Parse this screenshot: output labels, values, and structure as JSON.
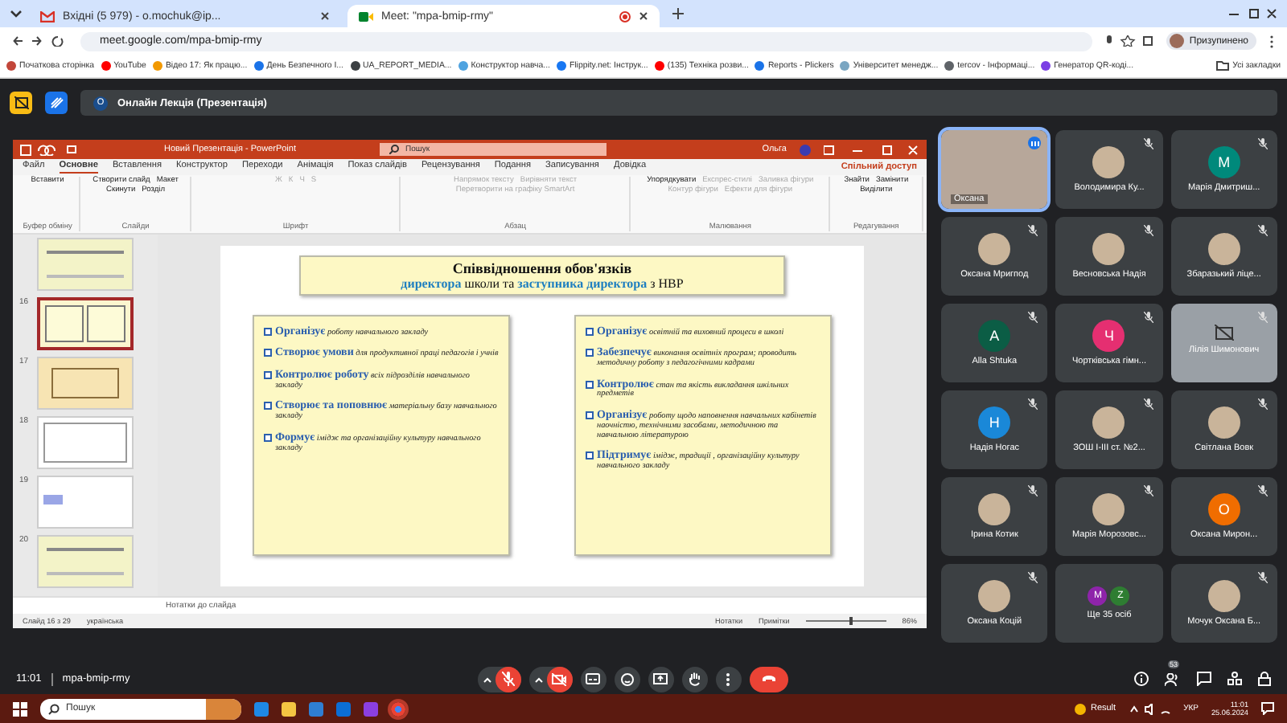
{
  "browser": {
    "tabs": [
      {
        "title": "Вхідні (5 979) - o.mochuk@ip...",
        "kind": "mail",
        "selected": false
      },
      {
        "title": "Meet: \"mpa-bmip-rmy\"",
        "kind": "meet",
        "selected": true
      }
    ],
    "url": "meet.google.com/mpa-bmip-rmy",
    "profile_label": "Призупинено",
    "bookmarks": [
      {
        "title": "Початкова сторінка",
        "color": "#c2463a"
      },
      {
        "title": "YouTube",
        "color": "#ff0000"
      },
      {
        "title": "Відео 17: Як працю...",
        "color": "#f29900"
      },
      {
        "title": "День Безпечного І...",
        "color": "#1a73e8"
      },
      {
        "title": "UA_REPORT_MEDIA...",
        "color": "#3c4043"
      },
      {
        "title": "Конструктор навча...",
        "color": "#4fa3e0"
      },
      {
        "title": "Flippity.net: Інструк...",
        "color": "#1877f2"
      },
      {
        "title": "(135) Техніка розви...",
        "color": "#ff0000"
      },
      {
        "title": "Reports - Plickers",
        "color": "#1a73e8"
      },
      {
        "title": "Університет менедж...",
        "color": "#7aa6c2"
      },
      {
        "title": "tercov - Інформаці...",
        "color": "#5f6368"
      },
      {
        "title": "Генератор QR-коді...",
        "color": "#7b3fe4"
      }
    ],
    "all_bookmarks": "Усі закладки"
  },
  "meet_header": {
    "initial": "О",
    "title": "Онлайн Лекція (Презентація)"
  },
  "powerpoint": {
    "title": "Новий Презентація - PowerPoint",
    "search": "Пошук",
    "user": "Ольга",
    "menu": [
      {
        "label": "Файл",
        "selected": false
      },
      {
        "label": "Основне",
        "selected": true
      },
      {
        "label": "Вставлення",
        "selected": false
      },
      {
        "label": "Конструктор",
        "selected": false
      },
      {
        "label": "Переходи",
        "selected": false
      },
      {
        "label": "Анімація",
        "selected": false
      },
      {
        "label": "Показ слайдів",
        "selected": false
      },
      {
        "label": "Рецензування",
        "selected": false
      },
      {
        "label": "Подання",
        "selected": false
      },
      {
        "label": "Записування",
        "selected": false
      },
      {
        "label": "Довідка",
        "selected": false
      }
    ],
    "share": "Спільний доступ",
    "ribbon": [
      {
        "label": "Буфер обміну",
        "buttons": [
          {
            "label": "Вставити",
            "disabled": false
          }
        ]
      },
      {
        "label": "Слайди",
        "buttons": [
          {
            "label": "Створити слайд",
            "disabled": false
          },
          {
            "label": "Макет",
            "disabled": false
          },
          {
            "label": "Скинути",
            "disabled": false
          },
          {
            "label": "Розділ",
            "disabled": false
          }
        ]
      },
      {
        "label": "Шрифт",
        "buttons": [
          {
            "label": "Ж",
            "disabled": true
          },
          {
            "label": "К",
            "disabled": true
          },
          {
            "label": "Ч",
            "disabled": true
          },
          {
            "label": "S",
            "disabled": true
          }
        ]
      },
      {
        "label": "Абзац",
        "buttons": [
          {
            "label": "Напрямок тексту",
            "disabled": true
          },
          {
            "label": "Вирівняти текст",
            "disabled": true
          },
          {
            "label": "Перетворити на графіку SmartArt",
            "disabled": true
          }
        ]
      },
      {
        "label": "Малювання",
        "buttons": [
          {
            "label": "Упорядкувати",
            "disabled": false
          },
          {
            "label": "Експрес-стилі",
            "disabled": true
          },
          {
            "label": "Заливка фігури",
            "disabled": true
          },
          {
            "label": "Контур фігури",
            "disabled": true
          },
          {
            "label": "Ефекти для фігури",
            "disabled": true
          }
        ]
      },
      {
        "label": "Редагування",
        "buttons": [
          {
            "label": "Знайти",
            "disabled": false
          },
          {
            "label": "Замінити",
            "disabled": false
          },
          {
            "label": "Виділити",
            "disabled": false
          }
        ]
      }
    ],
    "thumbnails": [
      {
        "kind": "text",
        "selected": false
      },
      {
        "number": "16",
        "kind": "columns",
        "selected": true
      },
      {
        "number": "17",
        "kind": "boxes",
        "selected": false
      },
      {
        "number": "18",
        "kind": "table",
        "selected": false
      },
      {
        "number": "19",
        "kind": "mindmap",
        "selected": false
      },
      {
        "number": "20",
        "kind": "text",
        "selected": false
      }
    ],
    "slide": {
      "title": "Співвідношення обов'язків",
      "subtitle": [
        {
          "text": "директора",
          "accent": true
        },
        {
          "text": " школи та ",
          "accent": false
        },
        {
          "text": "заступника директора",
          "accent": true
        },
        {
          "text": " з  НВР",
          "accent": false
        }
      ],
      "columns": [
        [
          {
            "verb": "Організує",
            "rest": "роботу навчального закладу"
          },
          {
            "verb": "Створює умови",
            "rest": "для продуктивної праці педагогів і учнів"
          },
          {
            "verb": "Контролює роботу",
            "rest": "всіх підрозділів навчального закладу"
          },
          {
            "verb": "Створює та поповнює",
            "rest": "матеріальну базу навчального закладу"
          },
          {
            "verb": "Формує",
            "rest": "імідж та організаційну культуру навчального закладу"
          }
        ],
        [
          {
            "verb": "Організує",
            "rest": "освітній та виховний процеси в школі"
          },
          {
            "verb": "Забезпечує",
            "rest": "виконання освітніх програм; проводить методичну роботу з педагогічними кадрами"
          },
          {
            "verb": "Контролює",
            "rest": "стан та якість викладання шкільних предметів"
          },
          {
            "verb": "Організує",
            "rest": "роботу щодо наповнення навчальних кабінетів наочністю, технічними засобами, методичною та навчальною літературою"
          },
          {
            "verb": "Підтримує",
            "rest": "імідж, традиції , організаційну культуру навчального закладу"
          }
        ]
      ]
    },
    "notes": "Нотатки до слайда",
    "status": {
      "slide": "Слайд 16 з 29",
      "language": "українська",
      "notes": "Нотатки",
      "comments": "Примітки",
      "zoom_slider": {
        "level": 0.55
      },
      "zoom": "86%"
    }
  },
  "participants": [
    {
      "name": "Оксана",
      "kind": "video",
      "speaking": true,
      "muted": false
    },
    {
      "name": "Володимира Ку...",
      "kind": "photo",
      "speaking": false,
      "muted": true
    },
    {
      "name": "Марія Дмитриш...",
      "kind": "letter",
      "letter": "М",
      "color": "#00897b",
      "speaking": false,
      "muted": true
    },
    {
      "name": "Оксана Мригпод",
      "kind": "photo",
      "speaking": false,
      "muted": true
    },
    {
      "name": "Весновська Надія",
      "kind": "photo",
      "speaking": false,
      "muted": true
    },
    {
      "name": "Збаразький ліце...",
      "kind": "photo",
      "speaking": false,
      "muted": true
    },
    {
      "name": "Alla Shtuka",
      "kind": "letter",
      "letter": "A",
      "color": "#0b5d45",
      "speaking": false,
      "muted": true
    },
    {
      "name": "Чортківська гімн...",
      "kind": "letter",
      "letter": "Ч",
      "color": "#e52f71",
      "speaking": false,
      "muted": true
    },
    {
      "name": "Лілія Шимонович",
      "kind": "camera_off",
      "speaking": false,
      "muted": true
    },
    {
      "name": "Надія Ногас",
      "kind": "letter",
      "letter": "Н",
      "color": "#1a88d8",
      "speaking": false,
      "muted": true
    },
    {
      "name": "ЗОШ І-ІІІ ст. №2...",
      "kind": "photo",
      "speaking": false,
      "muted": true
    },
    {
      "name": "Світлана Вовк",
      "kind": "photo",
      "speaking": false,
      "muted": true
    },
    {
      "name": "Ірина Котик",
      "kind": "photo",
      "speaking": false,
      "muted": true
    },
    {
      "name": "Марія Морозовс...",
      "kind": "photo",
      "speaking": false,
      "muted": true
    },
    {
      "name": "Оксана Мирон...",
      "kind": "letter",
      "letter": "О",
      "color": "#f06d00",
      "speaking": false,
      "muted": true
    },
    {
      "name": "Оксана Коцій",
      "kind": "photo",
      "speaking": false,
      "muted": true
    },
    {
      "name": "Ще 35 осіб",
      "kind": "more",
      "letters": [
        {
          "letter": "M",
          "color": "#8e24aa"
        },
        {
          "letter": "Z",
          "color": "#2e7d32"
        }
      ],
      "speaking": false,
      "muted": false
    },
    {
      "name": "Мочук Оксана Б...",
      "kind": "photo",
      "speaking": false,
      "muted": true
    }
  ],
  "meet_bar": {
    "time": "11:01",
    "code": "mpa-bmip-rmy",
    "controls": [
      {
        "kind": "mic",
        "off": true,
        "menu": true
      },
      {
        "kind": "camera",
        "off": true,
        "menu": true
      },
      {
        "kind": "captions",
        "off": false,
        "menu": false
      },
      {
        "kind": "emoji",
        "off": false,
        "menu": false
      },
      {
        "kind": "present",
        "off": false,
        "menu": false
      },
      {
        "kind": "hand",
        "off": false,
        "menu": false
      },
      {
        "kind": "more",
        "off": false,
        "menu": false
      },
      {
        "kind": "leave",
        "off": false,
        "menu": false
      }
    ],
    "people_count": "53"
  },
  "taskbar": {
    "search": "Пошук",
    "weather": "Result",
    "language": "УКР",
    "time": "11:01",
    "date": "25.06.2024"
  }
}
